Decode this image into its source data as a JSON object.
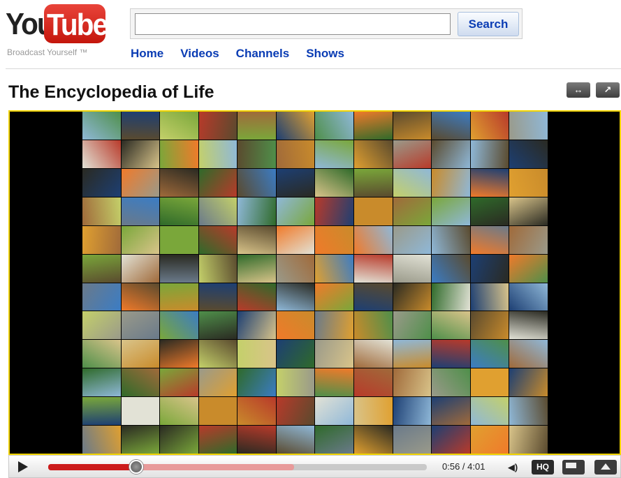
{
  "logo": {
    "part1": "You",
    "part2": "Tube",
    "tagline": "Broadcast Yourself ™"
  },
  "search": {
    "value": "",
    "placeholder": "",
    "button_label": "Search"
  },
  "nav": {
    "items": [
      "Home",
      "Videos",
      "Channels",
      "Shows"
    ]
  },
  "video": {
    "title": "The Encyclopedia of Life",
    "expand_icon": "expand-arrows-icon",
    "popout_icon": "popout-arrow-icon"
  },
  "player": {
    "current_time": "0:56",
    "duration": "4:01",
    "time_display": "0:56 / 4:01",
    "played_fraction": 0.232,
    "loaded_fraction": 0.65,
    "hq_label": "HQ",
    "colors": {
      "accent": "#f2d400",
      "played": "#cc1b1b",
      "brand": "#e52d27",
      "link": "#0a3cb4"
    }
  }
}
